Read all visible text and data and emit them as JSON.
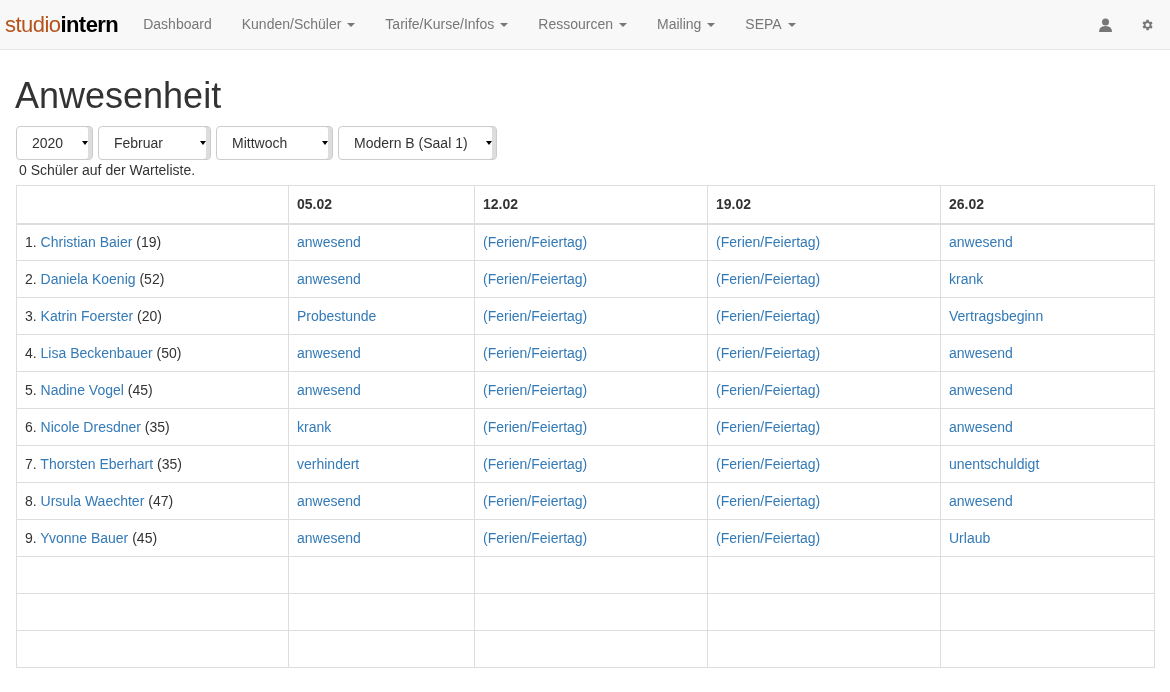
{
  "logo": {
    "part_1": "studio",
    "part_2": "intern"
  },
  "nav": [
    {
      "label": "Dashboard",
      "dropdown": false
    },
    {
      "label": "Kunden/Schüler",
      "dropdown": true
    },
    {
      "label": "Tarife/Kurse/Infos",
      "dropdown": true
    },
    {
      "label": "Ressourcen",
      "dropdown": true
    },
    {
      "label": "Mailing",
      "dropdown": true
    },
    {
      "label": "SEPA",
      "dropdown": true
    }
  ],
  "title": "Anwesenheit",
  "filters": [
    "2020",
    "Februar",
    "Mittwoch",
    "Modern B (Saal 1)"
  ],
  "waitlist": "0 Schüler auf der Warteliste.",
  "table": {
    "columns": [
      "05.02",
      "12.02",
      "19.02",
      "26.02"
    ],
    "rows": [
      {
        "number": "1.",
        "name": "Christian Baier",
        "age": "(19)",
        "cells": [
          "anwesend",
          "(Ferien/Feiertag)",
          "(Ferien/Feiertag)",
          "anwesend"
        ]
      },
      {
        "number": "2.",
        "name": "Daniela Koenig",
        "age": "(52)",
        "cells": [
          "anwesend",
          "(Ferien/Feiertag)",
          "(Ferien/Feiertag)",
          "krank"
        ]
      },
      {
        "number": "3.",
        "name": "Katrin Foerster",
        "age": "(20)",
        "cells": [
          "Probestunde",
          "(Ferien/Feiertag)",
          "(Ferien/Feiertag)",
          "Vertragsbeginn"
        ]
      },
      {
        "number": "4.",
        "name": "Lisa Beckenbauer",
        "age": "(50)",
        "cells": [
          "anwesend",
          "(Ferien/Feiertag)",
          "(Ferien/Feiertag)",
          "anwesend"
        ]
      },
      {
        "number": "5.",
        "name": "Nadine Vogel",
        "age": "(45)",
        "cells": [
          "anwesend",
          "(Ferien/Feiertag)",
          "(Ferien/Feiertag)",
          "anwesend"
        ]
      },
      {
        "number": "6.",
        "name": "Nicole Dresdner",
        "age": "(35)",
        "cells": [
          "krank",
          "(Ferien/Feiertag)",
          "(Ferien/Feiertag)",
          "anwesend"
        ]
      },
      {
        "number": "7.",
        "name": "Thorsten Eberhart",
        "age": "(35)",
        "cells": [
          "verhindert",
          "(Ferien/Feiertag)",
          "(Ferien/Feiertag)",
          "unentschuldigt"
        ]
      },
      {
        "number": "8.",
        "name": "Ursula Waechter",
        "age": "(47)",
        "cells": [
          "anwesend",
          "(Ferien/Feiertag)",
          "(Ferien/Feiertag)",
          "anwesend"
        ]
      },
      {
        "number": "9.",
        "name": "Yvonne Bauer",
        "age": "(45)",
        "cells": [
          "anwesend",
          "(Ferien/Feiertag)",
          "(Ferien/Feiertag)",
          "Urlaub"
        ]
      }
    ]
  }
}
